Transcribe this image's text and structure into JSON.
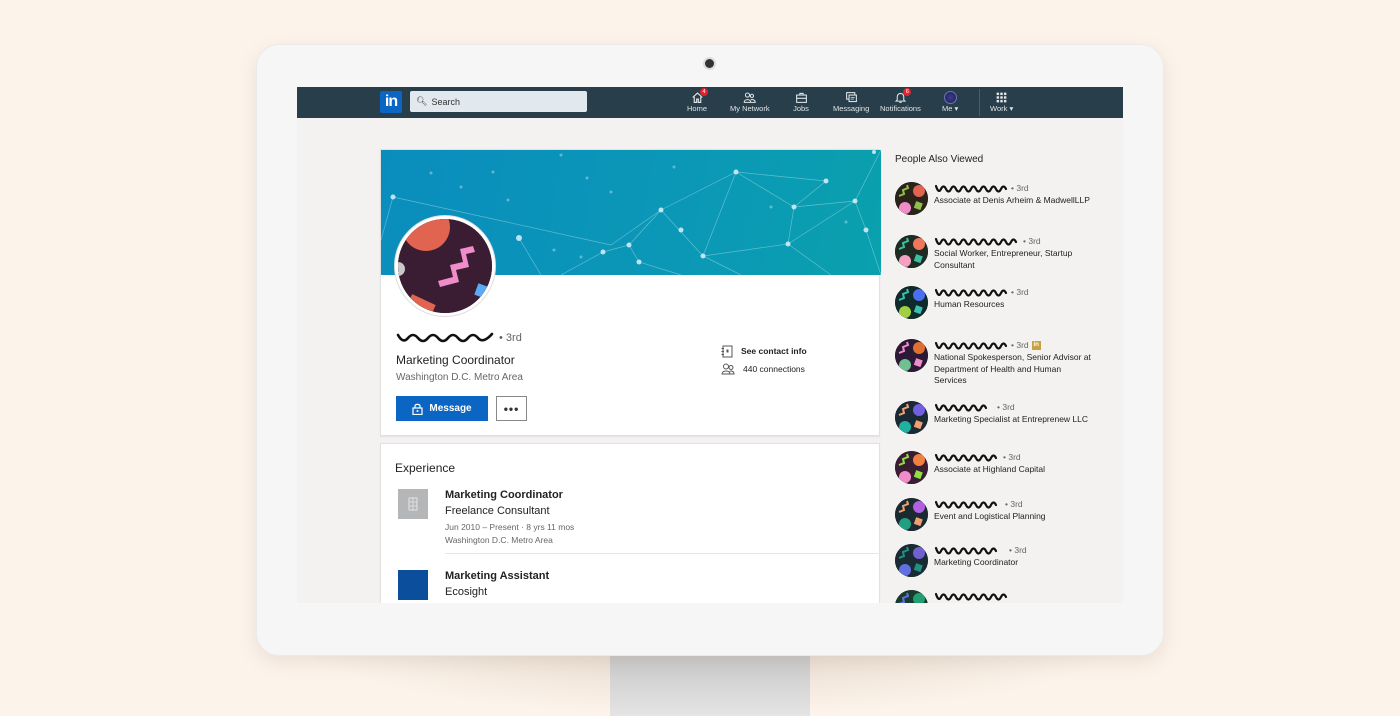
{
  "colors": {
    "nav_bg": "#283e4a",
    "brand_blue": "#0a66c2",
    "badge_red": "#e0242f",
    "page_bg": "#f3f2f1",
    "backdrop": "#fcf3ea",
    "premium_gold": "#c7a245"
  },
  "nav": {
    "logo": "in",
    "search_placeholder": "Search",
    "items": [
      {
        "label": "Home",
        "icon": "home-icon",
        "badge": "4"
      },
      {
        "label": "My Network",
        "icon": "network-icon",
        "badge": null
      },
      {
        "label": "Jobs",
        "icon": "briefcase-icon",
        "badge": null
      },
      {
        "label": "Messaging",
        "icon": "messaging-icon",
        "badge": null
      },
      {
        "label": "Notifications",
        "icon": "bell-icon",
        "badge": "6"
      },
      {
        "label": "Me",
        "icon": "avatar",
        "dropdown": true
      },
      {
        "label": "Work",
        "icon": "grid-icon",
        "dropdown": true
      }
    ]
  },
  "profile": {
    "name_redacted": true,
    "degree": "• 3rd",
    "headline": "Marketing Coordinator",
    "location": "Washington D.C. Metro Area",
    "message_button": "Message",
    "more_button": "•••",
    "contact_info_label": "See contact info",
    "connections_label": "440 connections"
  },
  "experience": {
    "title": "Experience",
    "items": [
      {
        "role": "Marketing Coordinator",
        "company": "Freelance Consultant",
        "dates": "Jun 2010 – Present · 8 yrs 11 mos",
        "location": "Washington D.C. Metro Area",
        "logo": "building-placeholder"
      },
      {
        "role": "Marketing Assistant",
        "company": "Ecosight",
        "logo": "blue-square"
      }
    ]
  },
  "people_also_viewed": {
    "title": "People Also Viewed",
    "items": [
      {
        "degree": "• 3rd",
        "description": "Associate at Denis Arheim & MadwellLLP",
        "premium": false
      },
      {
        "degree": "• 3rd",
        "description": "Social Worker, Entrepreneur, Startup Consultant",
        "premium": false
      },
      {
        "degree": "• 3rd",
        "description": "Human Resources",
        "premium": false
      },
      {
        "degree": "• 3rd",
        "description": "National Spokesperson, Senior Advisor at Department of Health and Human Services",
        "premium": true
      },
      {
        "degree": "• 3rd",
        "description": "Marketing Specialist at Entreprenew LLC",
        "premium": false
      },
      {
        "degree": "• 3rd",
        "description": "Associate at Highland Capital",
        "premium": false
      },
      {
        "degree": "• 3rd",
        "description": "Event and Logistical Planning",
        "premium": false
      },
      {
        "degree": "• 3rd",
        "description": "Marketing Coordinator",
        "premium": false
      },
      {
        "degree": "",
        "description": "",
        "premium": false
      }
    ],
    "premium_badge": "in"
  }
}
